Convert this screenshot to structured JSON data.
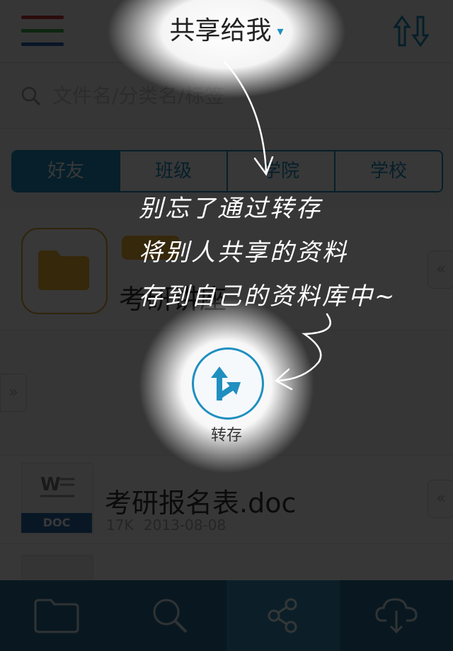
{
  "header": {
    "title": "共享给我",
    "title_chevron": "▾",
    "menu_icon": "hamburger-menu-icon",
    "sort_icon": "sort-up-down-icon",
    "menu_colors": [
      "#c6373a",
      "#3fa94d",
      "#2a67b2"
    ]
  },
  "search": {
    "placeholder": "文件名/分类名/标签",
    "icon": "search-icon"
  },
  "tabs": [
    {
      "label": "好友",
      "active": true
    },
    {
      "label": "班级",
      "active": false
    },
    {
      "label": "学院",
      "active": false
    },
    {
      "label": "学校",
      "active": false
    }
  ],
  "list": [
    {
      "type": "folder",
      "title": "考研讲座",
      "icon": "folder-icon"
    },
    {
      "type": "doc",
      "title": "考研报名表.doc",
      "size": "17K",
      "date": "2013-08-08",
      "badge": "DOC",
      "icon": "word-doc-icon"
    }
  ],
  "expander_glyph": "«",
  "side_handle_glyph": "»",
  "action": {
    "label": "转存",
    "icon": "save-branch-arrow-icon"
  },
  "hint": {
    "line1": "别忘了通过转存",
    "line2": "将别人共享的资料",
    "line3": "存到自己的资料库中~"
  },
  "bottom_nav": [
    {
      "icon": "folder-icon",
      "active": false
    },
    {
      "icon": "search-icon",
      "active": false
    },
    {
      "icon": "share-icon",
      "active": true
    },
    {
      "icon": "cloud-download-icon",
      "active": false
    }
  ],
  "colors": {
    "accent": "#1f8fc0",
    "bottom_bar": "#2c6d92",
    "folder_border": "#d6a431",
    "doc_band": "#2a6aa8"
  }
}
